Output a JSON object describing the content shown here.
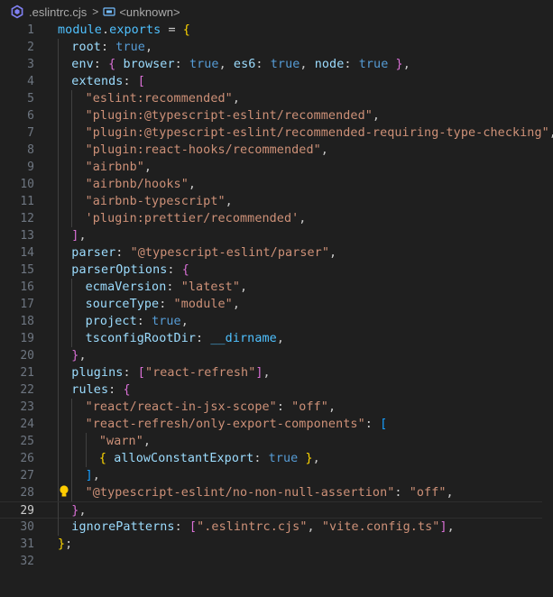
{
  "breadcrumb": {
    "file_name": ".eslintrc.cjs",
    "separator": ">",
    "symbol": "<unknown>",
    "file_icon": "eslint-icon",
    "symbol_icon": "symbol-variable-icon"
  },
  "editor": {
    "current_line": 29,
    "lightbulb_line": 28,
    "lines": [
      {
        "n": "1",
        "indent": 0,
        "tokens": [
          [
            "module",
            "t-var"
          ],
          [
            ".",
            "t-punc"
          ],
          [
            "exports",
            "t-var"
          ],
          [
            " = ",
            "t-punc"
          ],
          [
            "{",
            "b1"
          ]
        ]
      },
      {
        "n": "2",
        "indent": 1,
        "tokens": [
          [
            "root",
            "t-prop"
          ],
          [
            ": ",
            "t-punc"
          ],
          [
            "true",
            "t-kw"
          ],
          [
            ",",
            "t-punc"
          ]
        ]
      },
      {
        "n": "3",
        "indent": 1,
        "tokens": [
          [
            "env",
            "t-prop"
          ],
          [
            ": ",
            "t-punc"
          ],
          [
            "{",
            "b2"
          ],
          [
            " ",
            "t-punc"
          ],
          [
            "browser",
            "t-prop"
          ],
          [
            ": ",
            "t-punc"
          ],
          [
            "true",
            "t-kw"
          ],
          [
            ", ",
            "t-punc"
          ],
          [
            "es6",
            "t-prop"
          ],
          [
            ": ",
            "t-punc"
          ],
          [
            "true",
            "t-kw"
          ],
          [
            ", ",
            "t-punc"
          ],
          [
            "node",
            "t-prop"
          ],
          [
            ": ",
            "t-punc"
          ],
          [
            "true",
            "t-kw"
          ],
          [
            " ",
            "t-punc"
          ],
          [
            "}",
            "b2"
          ],
          [
            ",",
            "t-punc"
          ]
        ]
      },
      {
        "n": "4",
        "indent": 1,
        "tokens": [
          [
            "extends",
            "t-prop"
          ],
          [
            ": ",
            "t-punc"
          ],
          [
            "[",
            "b2"
          ]
        ]
      },
      {
        "n": "5",
        "indent": 2,
        "tokens": [
          [
            "\"eslint:recommended\"",
            "t-str"
          ],
          [
            ",",
            "t-punc"
          ]
        ]
      },
      {
        "n": "6",
        "indent": 2,
        "tokens": [
          [
            "\"plugin:@typescript-eslint/recommended\"",
            "t-str"
          ],
          [
            ",",
            "t-punc"
          ]
        ]
      },
      {
        "n": "7",
        "indent": 2,
        "tokens": [
          [
            "\"plugin:@typescript-eslint/recommended-requiring-type-checking\"",
            "t-str"
          ],
          [
            ",",
            "t-punc"
          ]
        ]
      },
      {
        "n": "8",
        "indent": 2,
        "tokens": [
          [
            "\"plugin:react-hooks/recommended\"",
            "t-str"
          ],
          [
            ",",
            "t-punc"
          ]
        ]
      },
      {
        "n": "9",
        "indent": 2,
        "tokens": [
          [
            "\"airbnb\"",
            "t-str"
          ],
          [
            ",",
            "t-punc"
          ]
        ]
      },
      {
        "n": "10",
        "indent": 2,
        "tokens": [
          [
            "\"airbnb/hooks\"",
            "t-str"
          ],
          [
            ",",
            "t-punc"
          ]
        ]
      },
      {
        "n": "11",
        "indent": 2,
        "tokens": [
          [
            "\"airbnb-typescript\"",
            "t-str"
          ],
          [
            ",",
            "t-punc"
          ]
        ]
      },
      {
        "n": "12",
        "indent": 2,
        "tokens": [
          [
            "'plugin:prettier/recommended'",
            "t-str"
          ],
          [
            ",",
            "t-punc"
          ]
        ]
      },
      {
        "n": "13",
        "indent": 1,
        "tokens": [
          [
            "]",
            "b2"
          ],
          [
            ",",
            "t-punc"
          ]
        ]
      },
      {
        "n": "14",
        "indent": 1,
        "tokens": [
          [
            "parser",
            "t-prop"
          ],
          [
            ": ",
            "t-punc"
          ],
          [
            "\"@typescript-eslint/parser\"",
            "t-str"
          ],
          [
            ",",
            "t-punc"
          ]
        ]
      },
      {
        "n": "15",
        "indent": 1,
        "tokens": [
          [
            "parserOptions",
            "t-prop"
          ],
          [
            ": ",
            "t-punc"
          ],
          [
            "{",
            "b2"
          ]
        ]
      },
      {
        "n": "16",
        "indent": 2,
        "tokens": [
          [
            "ecmaVersion",
            "t-prop"
          ],
          [
            ": ",
            "t-punc"
          ],
          [
            "\"latest\"",
            "t-str"
          ],
          [
            ",",
            "t-punc"
          ]
        ]
      },
      {
        "n": "17",
        "indent": 2,
        "tokens": [
          [
            "sourceType",
            "t-prop"
          ],
          [
            ": ",
            "t-punc"
          ],
          [
            "\"module\"",
            "t-str"
          ],
          [
            ",",
            "t-punc"
          ]
        ]
      },
      {
        "n": "18",
        "indent": 2,
        "tokens": [
          [
            "project",
            "t-prop"
          ],
          [
            ": ",
            "t-punc"
          ],
          [
            "true",
            "t-kw"
          ],
          [
            ",",
            "t-punc"
          ]
        ]
      },
      {
        "n": "19",
        "indent": 2,
        "tokens": [
          [
            "tsconfigRootDir",
            "t-prop"
          ],
          [
            ": ",
            "t-punc"
          ],
          [
            "__dirname",
            "t-var"
          ],
          [
            ",",
            "t-punc"
          ]
        ]
      },
      {
        "n": "20",
        "indent": 1,
        "tokens": [
          [
            "}",
            "b2"
          ],
          [
            ",",
            "t-punc"
          ]
        ]
      },
      {
        "n": "21",
        "indent": 1,
        "tokens": [
          [
            "plugins",
            "t-prop"
          ],
          [
            ": ",
            "t-punc"
          ],
          [
            "[",
            "b2"
          ],
          [
            "\"react-refresh\"",
            "t-str"
          ],
          [
            "]",
            "b2"
          ],
          [
            ",",
            "t-punc"
          ]
        ]
      },
      {
        "n": "22",
        "indent": 1,
        "tokens": [
          [
            "rules",
            "t-prop"
          ],
          [
            ": ",
            "t-punc"
          ],
          [
            "{",
            "b2"
          ]
        ]
      },
      {
        "n": "23",
        "indent": 2,
        "tokens": [
          [
            "\"react/react-in-jsx-scope\"",
            "t-str"
          ],
          [
            ": ",
            "t-punc"
          ],
          [
            "\"off\"",
            "t-str"
          ],
          [
            ",",
            "t-punc"
          ]
        ]
      },
      {
        "n": "24",
        "indent": 2,
        "tokens": [
          [
            "\"react-refresh/only-export-components\"",
            "t-str"
          ],
          [
            ": ",
            "t-punc"
          ],
          [
            "[",
            "b3"
          ]
        ]
      },
      {
        "n": "25",
        "indent": 3,
        "tokens": [
          [
            "\"warn\"",
            "t-str"
          ],
          [
            ",",
            "t-punc"
          ]
        ]
      },
      {
        "n": "26",
        "indent": 3,
        "tokens": [
          [
            "{",
            "b1"
          ],
          [
            " ",
            "t-punc"
          ],
          [
            "allowConstantExport",
            "t-prop"
          ],
          [
            ": ",
            "t-punc"
          ],
          [
            "true",
            "t-kw"
          ],
          [
            " ",
            "t-punc"
          ],
          [
            "}",
            "b1"
          ],
          [
            ",",
            "t-punc"
          ]
        ]
      },
      {
        "n": "27",
        "indent": 2,
        "tokens": [
          [
            "]",
            "b3"
          ],
          [
            ",",
            "t-punc"
          ]
        ]
      },
      {
        "n": "28",
        "indent": 2,
        "tokens": [
          [
            "\"@typescript-eslint/no-non-null-assertion\"",
            "t-str"
          ],
          [
            ": ",
            "t-punc"
          ],
          [
            "\"off\"",
            "t-str"
          ],
          [
            ",",
            "t-punc"
          ]
        ]
      },
      {
        "n": "29",
        "indent": 1,
        "tokens": [
          [
            "}",
            "b2"
          ],
          [
            ",",
            "t-punc"
          ]
        ]
      },
      {
        "n": "30",
        "indent": 1,
        "tokens": [
          [
            "ignorePatterns",
            "t-prop"
          ],
          [
            ": ",
            "t-punc"
          ],
          [
            "[",
            "b2"
          ],
          [
            "\".eslintrc.cjs\"",
            "t-str"
          ],
          [
            ", ",
            "t-punc"
          ],
          [
            "\"vite.config.ts\"",
            "t-str"
          ],
          [
            "]",
            "b2"
          ],
          [
            ",",
            "t-punc"
          ]
        ]
      },
      {
        "n": "31",
        "indent": 0,
        "tokens": [
          [
            "}",
            "b1"
          ],
          [
            ";",
            "t-punc"
          ]
        ]
      },
      {
        "n": "32",
        "indent": 0,
        "tokens": []
      }
    ]
  },
  "colors": {
    "background": "#1f1f1f",
    "variable": "#4fc1ff",
    "property": "#9cdcfe",
    "keyword": "#569cd6",
    "string": "#ce9178",
    "bracket_level1": "#ffd700",
    "bracket_level2": "#da70d6",
    "bracket_level3": "#179fff",
    "lightbulb": "#ffcc00"
  }
}
